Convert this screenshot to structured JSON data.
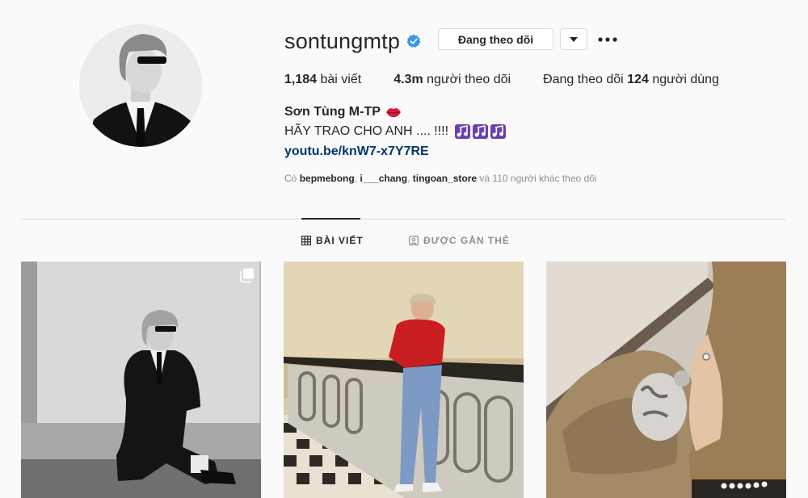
{
  "profile": {
    "username": "sontungmtp",
    "follow_label": "Đang theo dõi",
    "stats": {
      "posts_count": "1,184",
      "posts_label": "bài viết",
      "followers_count": "4.3m",
      "followers_label": "người theo dõi",
      "following_prefix": "Đang theo dõi",
      "following_count": "124",
      "following_label": "người dùng"
    },
    "full_name": "Sơn Tùng M-TP",
    "bio": "HÃY TRAO CHO ANH .... !!!!",
    "link": "youtu.be/knW7-x7Y7RE",
    "followed_by": {
      "prefix": "Có",
      "user1": "bepmebong",
      "user2": "i___chang",
      "user3": "tingoan_store",
      "suffix": "và 110 người khác theo dõi"
    }
  },
  "tabs": {
    "posts": "BÀI VIẾT",
    "tagged": "ĐƯỢC GẮN THẺ"
  },
  "icons": {
    "verified": "verified-badge-icon",
    "lips": "lips-emoji-icon",
    "music_notes": "music-notes-icon",
    "chevron": "chevron-down-icon",
    "more": "more-dots-icon",
    "grid": "grid-icon",
    "tagged": "tagged-person-icon",
    "multi": "multiple-photos-icon"
  },
  "colors": {
    "verified_blue": "#3897f0",
    "link_blue": "#00376b",
    "text": "#262626",
    "muted": "#8e8e8e",
    "border": "#dbdbdb",
    "music_purple": "#6a3fb5",
    "lips_red": "#d81b3c"
  }
}
